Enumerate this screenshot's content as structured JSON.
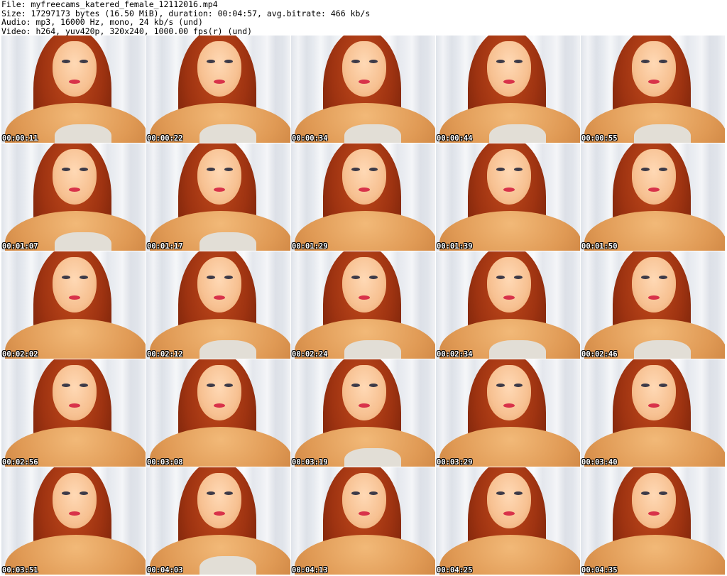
{
  "header": {
    "file_line": "File: myfreecams_katered_female_12112016.mp4",
    "size_line": "Size: 17297173 bytes (16.50 MiB), duration: 00:04:57, avg.bitrate: 466 kb/s",
    "audio_line": "Audio: mp3, 16000 Hz, mono, 24 kb/s (und)",
    "video_line": "Video: h264, yuv420p, 320x240, 1000.00 fps(r) (und)"
  },
  "thumbnails": [
    {
      "timestamp": "00:00:11"
    },
    {
      "timestamp": "00:00:22"
    },
    {
      "timestamp": "00:00:34"
    },
    {
      "timestamp": "00:00:44"
    },
    {
      "timestamp": "00:00:55"
    },
    {
      "timestamp": "00:01:07"
    },
    {
      "timestamp": "00:01:17"
    },
    {
      "timestamp": "00:01:29"
    },
    {
      "timestamp": "00:01:39"
    },
    {
      "timestamp": "00:01:50"
    },
    {
      "timestamp": "00:02:02"
    },
    {
      "timestamp": "00:02:12"
    },
    {
      "timestamp": "00:02:24"
    },
    {
      "timestamp": "00:02:34"
    },
    {
      "timestamp": "00:02:46"
    },
    {
      "timestamp": "00:02:56"
    },
    {
      "timestamp": "00:03:08"
    },
    {
      "timestamp": "00:03:19"
    },
    {
      "timestamp": "00:03:29"
    },
    {
      "timestamp": "00:03:40"
    },
    {
      "timestamp": "00:03:51"
    },
    {
      "timestamp": "00:04:03"
    },
    {
      "timestamp": "00:04:13"
    },
    {
      "timestamp": "00:04:25"
    },
    {
      "timestamp": "00:04:35"
    }
  ]
}
